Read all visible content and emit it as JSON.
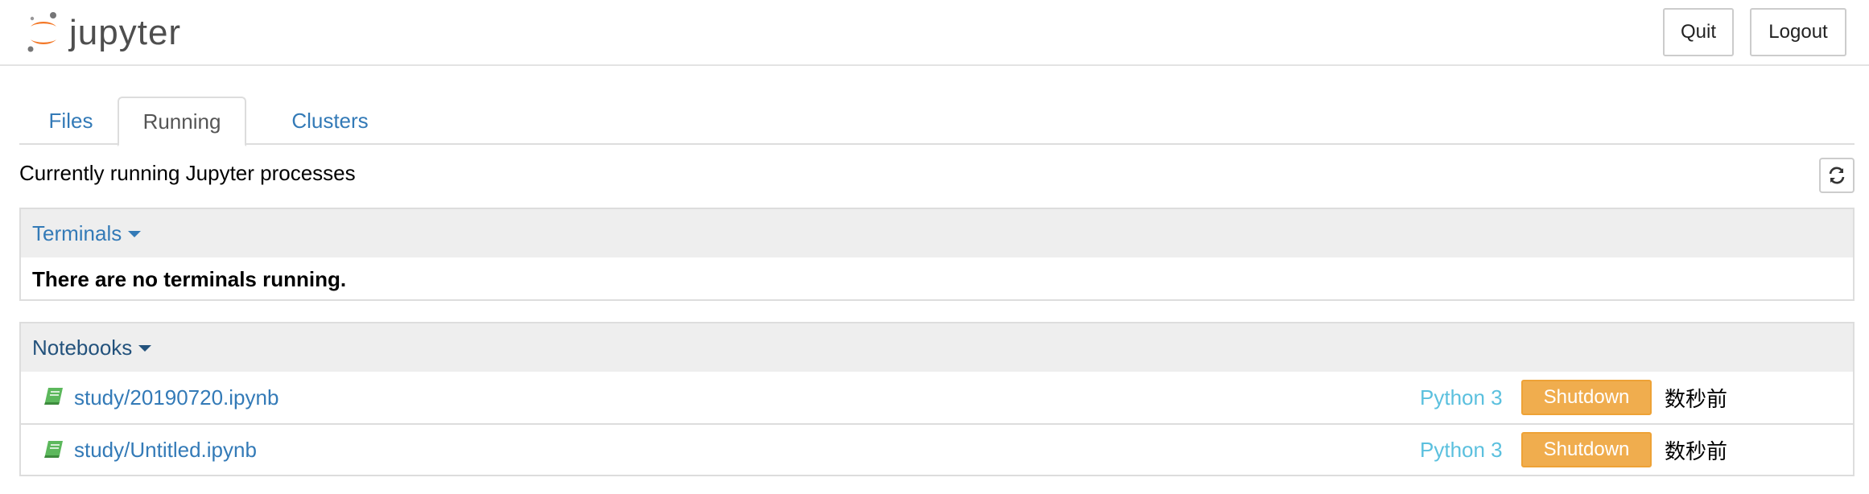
{
  "header": {
    "logo_text": "jupyter",
    "quit_label": "Quit",
    "logout_label": "Logout"
  },
  "tabs": [
    {
      "label": "Files",
      "active": false
    },
    {
      "label": "Running",
      "active": true
    },
    {
      "label": "Clusters",
      "active": false
    }
  ],
  "running": {
    "title": "Currently running Jupyter processes",
    "refresh_icon": "refresh-icon"
  },
  "terminals": {
    "heading": "Terminals",
    "empty_message": "There are no terminals running."
  },
  "notebooks": {
    "heading": "Notebooks",
    "items": [
      {
        "name": "study/20190720.ipynb",
        "kernel": "Python 3",
        "action": "Shutdown",
        "time": "数秒前"
      },
      {
        "name": "study/Untitled.ipynb",
        "kernel": "Python 3",
        "action": "Shutdown",
        "time": "数秒前"
      }
    ]
  },
  "colors": {
    "link": "#337ab7",
    "kernel": "#5bc0de",
    "shutdown": "#f0ad4e",
    "notebook_icon": "#5cb85c",
    "logo_orange": "#f37726"
  }
}
